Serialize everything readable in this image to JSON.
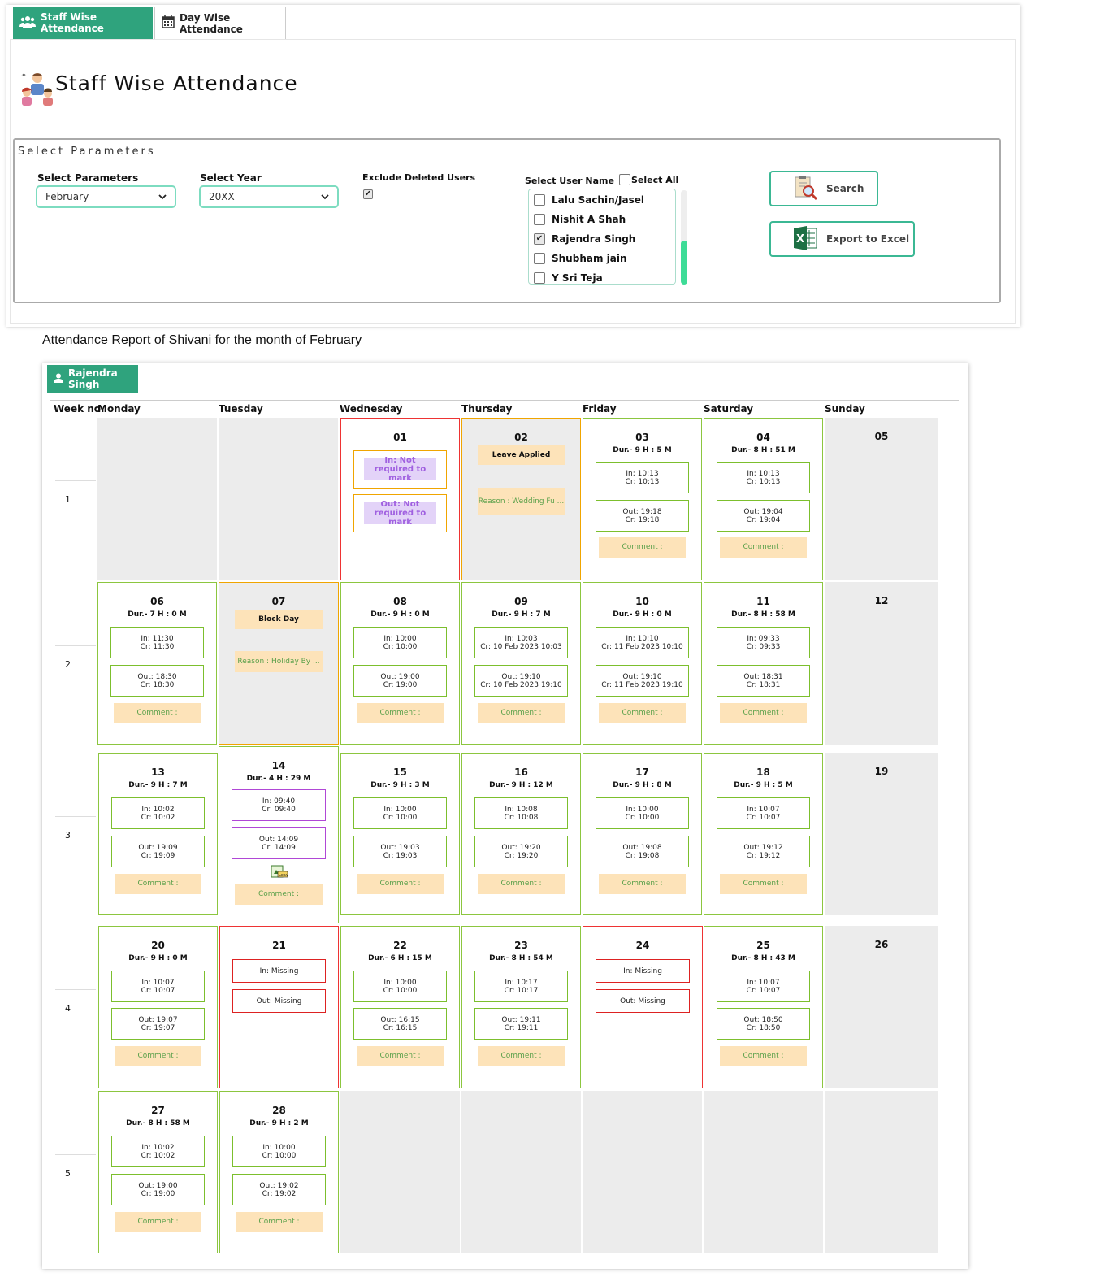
{
  "tabs": {
    "staff_wise": "Staff Wise Attendance",
    "day_wise": "Day Wise Attendance"
  },
  "page_title": "Staff Wise Attendance",
  "params": {
    "legend": "Select Parameters",
    "month_label": "Select Parameters",
    "month_value": "February",
    "year_label": "Select Year",
    "year_value": "20XX",
    "exclude_label": "Exclude Deleted Users",
    "exclude_checked": "✔",
    "user_label": "Select User Name",
    "select_all_label": "Select All",
    "users": [
      {
        "name": "Lalu Sachin/Jasel",
        "check": ""
      },
      {
        "name": "Nishit A Shah",
        "check": ""
      },
      {
        "name": "Rajendra Singh",
        "check": "✔"
      },
      {
        "name": "Shubham jain",
        "check": ""
      },
      {
        "name": "Y Sri Teja",
        "check": ""
      }
    ],
    "search_label": "Search",
    "export_label": "Export to Excel"
  },
  "report": {
    "title": "Attendance Report of Shivani for the month of February",
    "user_tab": "Rajendra Singh",
    "headers": [
      "Week no.",
      "Monday",
      "Tuesday",
      "Wednesday",
      "Thursday",
      "Friday",
      "Saturday",
      "Sunday"
    ],
    "weeks": [
      "1",
      "2",
      "3",
      "4",
      "5"
    ],
    "comment_label": "Comment :",
    "days": {
      "d01": {
        "num": "01",
        "in": "In: Not required to mark",
        "out": "Out: Not required to mark"
      },
      "d02": {
        "num": "02",
        "status": "Leave Applied",
        "reason": "Reason : Wedding Fu ..."
      },
      "d03": {
        "num": "03",
        "dur": "Dur.- 9 H : 5 M",
        "in1": "In: 10:13",
        "in2": "Cr: 10:13",
        "out1": "Out: 19:18",
        "out2": "Cr: 19:18"
      },
      "d04": {
        "num": "04",
        "dur": "Dur.- 8 H : 51 M",
        "in1": "In: 10:13",
        "in2": "Cr: 10:13",
        "out1": "Out: 19:04",
        "out2": "Cr: 19:04"
      },
      "d05": {
        "num": "05"
      },
      "d06": {
        "num": "06",
        "dur": "Dur.- 7 H : 0 M",
        "in1": "In: 11:30",
        "in2": "Cr: 11:30",
        "out1": "Out: 18:30",
        "out2": "Cr: 18:30"
      },
      "d07": {
        "num": "07",
        "status": "Block Day",
        "reason": "Reason : Holiday By ..."
      },
      "d08": {
        "num": "08",
        "dur": "Dur.- 9 H : 0 M",
        "in1": "In: 10:00",
        "in2": "Cr: 10:00",
        "out1": "Out: 19:00",
        "out2": "Cr: 19:00"
      },
      "d09": {
        "num": "09",
        "dur": "Dur.- 9 H : 7 M",
        "in1": "In: 10:03",
        "in2": "Cr: 10 Feb 2023 10:03",
        "out1": "Out: 19:10",
        "out2": "Cr: 10 Feb 2023 19:10"
      },
      "d10": {
        "num": "10",
        "dur": "Dur.- 9 H : 0 M",
        "in1": "In: 10:10",
        "in2": "Cr: 11 Feb 2023 10:10",
        "out1": "Out: 19:10",
        "out2": "Cr: 11 Feb 2023 19:10"
      },
      "d11": {
        "num": "11",
        "dur": "Dur.- 8 H : 58 M",
        "in1": "In: 09:33",
        "in2": "Cr: 09:33",
        "out1": "Out: 18:31",
        "out2": "Cr: 18:31"
      },
      "d12": {
        "num": "12"
      },
      "d13": {
        "num": "13",
        "dur": "Dur.- 9 H : 7 M",
        "in1": "In: 10:02",
        "in2": "Cr: 10:02",
        "out1": "Out: 19:09",
        "out2": "Cr: 19:09"
      },
      "d14": {
        "num": "14",
        "dur": "Dur.- 4 H : 29 M",
        "in1": "In: 09:40",
        "in2": "Cr: 09:40",
        "out1": "Out: 14:09",
        "out2": "Cr: 14:09"
      },
      "d15": {
        "num": "15",
        "dur": "Dur.- 9 H : 3 M",
        "in1": "In: 10:00",
        "in2": "Cr: 10:00",
        "out1": "Out: 19:03",
        "out2": "Cr: 19:03"
      },
      "d16": {
        "num": "16",
        "dur": "Dur.- 9 H : 12 M",
        "in1": "In: 10:08",
        "in2": "Cr: 10:08",
        "out1": "Out: 19:20",
        "out2": "Cr: 19:20"
      },
      "d17": {
        "num": "17",
        "dur": "Dur.- 9 H : 8 M",
        "in1": "In: 10:00",
        "in2": "Cr: 10:00",
        "out1": "Out: 19:08",
        "out2": "Cr: 19:08"
      },
      "d18": {
        "num": "18",
        "dur": "Dur.- 9 H : 5 M",
        "in1": "In: 10:07",
        "in2": "Cr: 10:07",
        "out1": "Out: 19:12",
        "out2": "Cr: 19:12"
      },
      "d19": {
        "num": "19"
      },
      "d20": {
        "num": "20",
        "dur": "Dur.- 9 H : 0 M",
        "in1": "In: 10:07",
        "in2": "Cr: 10:07",
        "out1": "Out: 19:07",
        "out2": "Cr: 19:07"
      },
      "d21": {
        "num": "21",
        "in": "In: Missing",
        "out": "Out: Missing"
      },
      "d22": {
        "num": "22",
        "dur": "Dur.- 6 H : 15 M",
        "in1": "In: 10:00",
        "in2": "Cr: 10:00",
        "out1": "Out: 16:15",
        "out2": "Cr: 16:15"
      },
      "d23": {
        "num": "23",
        "dur": "Dur.- 8 H : 54 M",
        "in1": "In: 10:17",
        "in2": "Cr: 10:17",
        "out1": "Out: 19:11",
        "out2": "Cr: 19:11"
      },
      "d24": {
        "num": "24",
        "in": "In: Missing",
        "out": "Out: Missing"
      },
      "d25": {
        "num": "25",
        "dur": "Dur.- 8 H : 43 M",
        "in1": "In: 10:07",
        "in2": "Cr: 10:07",
        "out1": "Out: 18:50",
        "out2": "Cr: 18:50"
      },
      "d26": {
        "num": "26"
      },
      "d27": {
        "num": "27",
        "dur": "Dur.- 8 H : 58 M",
        "in1": "In: 10:02",
        "in2": "Cr: 10:02",
        "out1": "Out: 19:00",
        "out2": "Cr: 19:00"
      },
      "d28": {
        "num": "28",
        "dur": "Dur.- 9 H : 2 M",
        "in1": "In: 10:00",
        "in2": "Cr: 10:00",
        "out1": "Out: 19:02",
        "out2": "Cr: 19:02"
      }
    }
  },
  "colors": {
    "accent": "#2fa37d",
    "present_border": "#8cc63f",
    "absent_border": "#e33333",
    "leave_border": "#f0a500",
    "comment_bg": "#fde3b9"
  }
}
